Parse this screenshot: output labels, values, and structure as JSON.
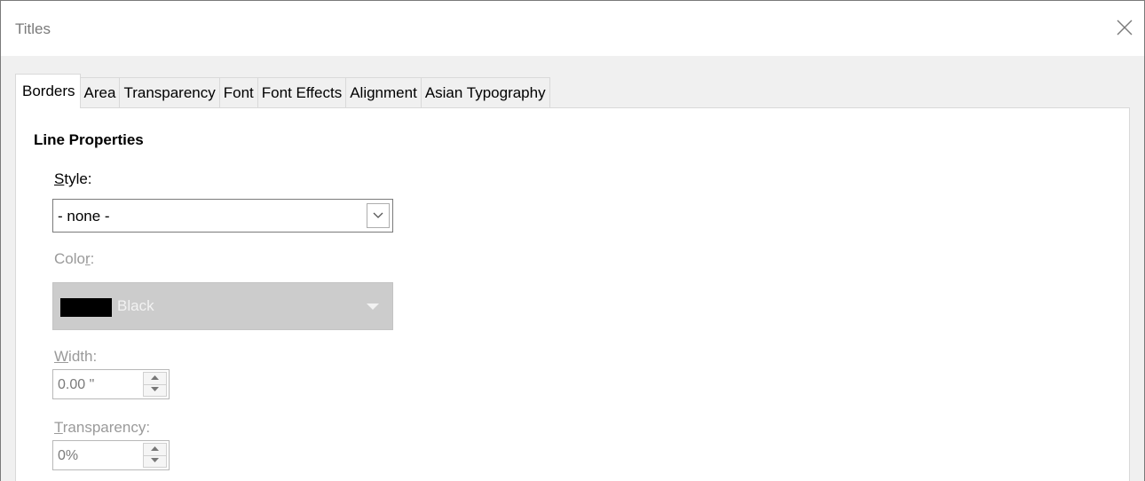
{
  "window": {
    "title": "Titles"
  },
  "tabs": [
    {
      "label": "Borders",
      "active": true
    },
    {
      "label": "Area",
      "active": false
    },
    {
      "label": "Transparency",
      "active": false
    },
    {
      "label": "Font",
      "active": false
    },
    {
      "label": "Font Effects",
      "active": false
    },
    {
      "label": "Alignment",
      "active": false
    },
    {
      "label": "Asian Typography",
      "active": false
    }
  ],
  "line_properties": {
    "heading": "Line Properties",
    "style": {
      "label_mnemonic": "S",
      "label_rest": "tyle:",
      "selected_value": "- none -"
    },
    "color": {
      "label_before": "Colo",
      "label_mnemonic": "r",
      "label_after": ":",
      "swatch_color": "#000000",
      "value": "Black",
      "enabled": false
    },
    "width": {
      "label_mnemonic": "W",
      "label_rest": "idth:",
      "value": "0.00 \"",
      "enabled": false
    },
    "transparency": {
      "label_mnemonic": "T",
      "label_rest": "ransparency:",
      "value": "0%",
      "enabled": false
    }
  },
  "icons": {
    "close": "close-icon",
    "dropdown": "chevron-down-icon",
    "color_dropdown": "triangle-down-icon",
    "spin_up": "spin-up-icon",
    "spin_down": "spin-down-icon"
  }
}
